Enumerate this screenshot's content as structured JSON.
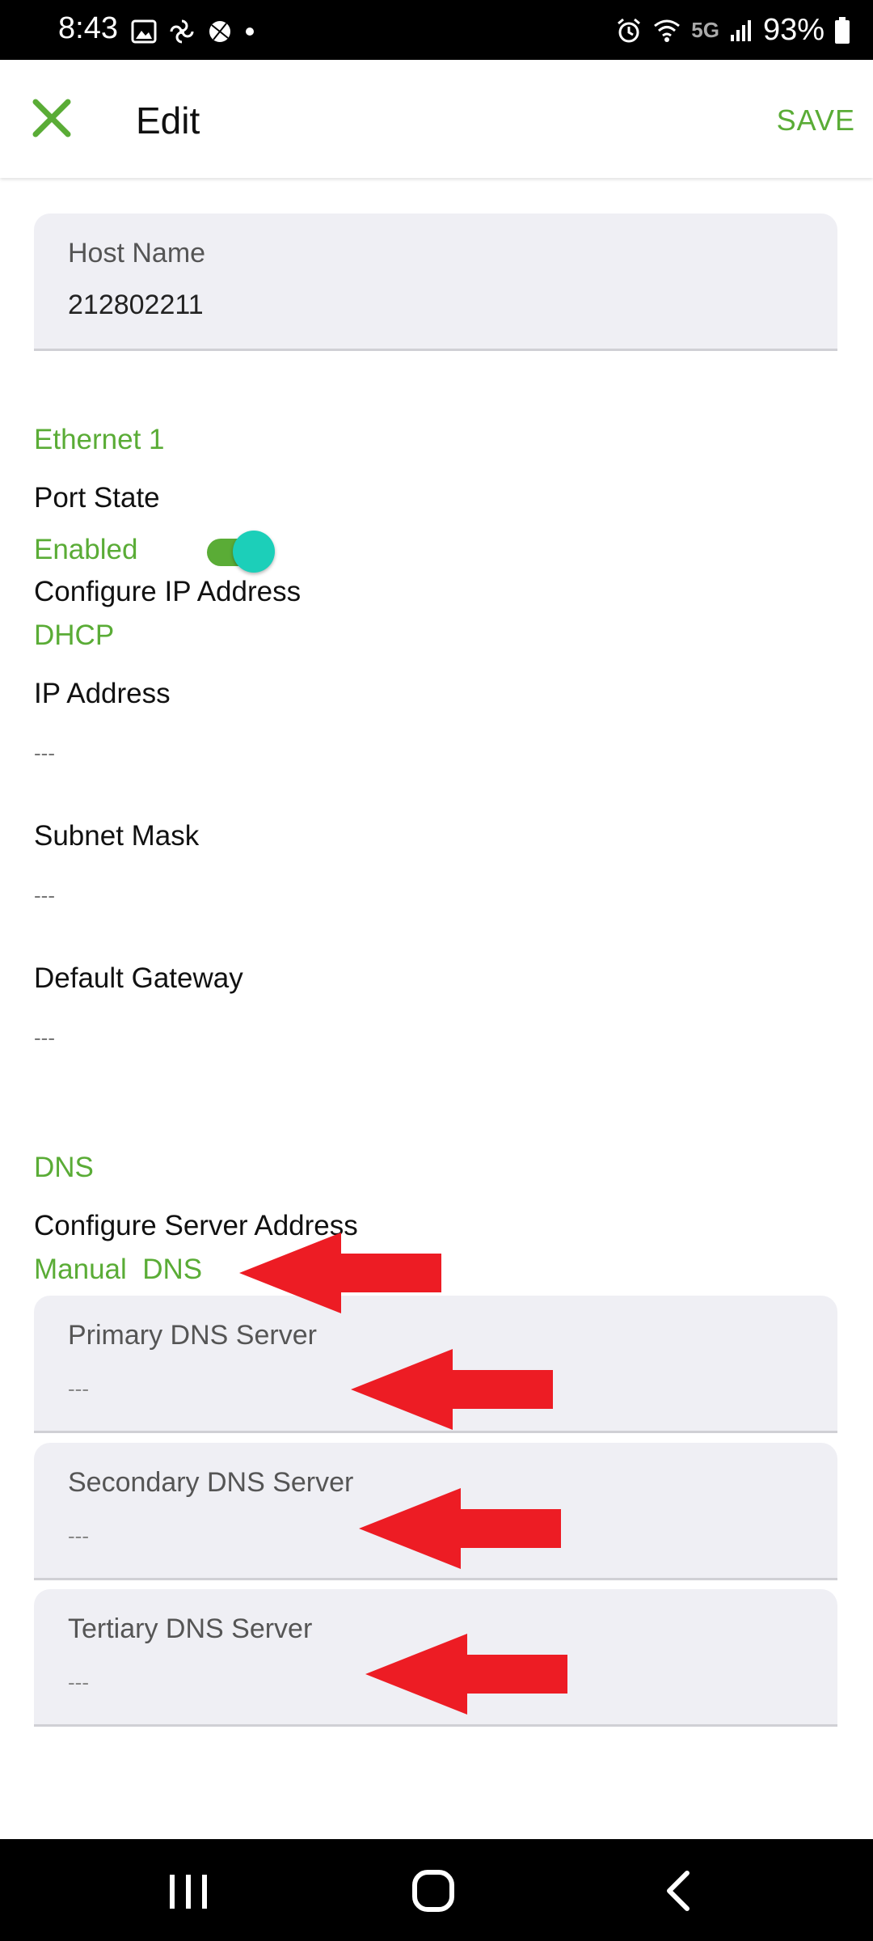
{
  "status_bar": {
    "time": "8:43",
    "network": "5G",
    "battery": "93%"
  },
  "app_bar": {
    "title": "Edit",
    "save_label": "SAVE",
    "close_icon": "close-x-icon"
  },
  "host": {
    "label": "Host Name",
    "value": "212802211"
  },
  "ethernet": {
    "section_title": "Ethernet 1",
    "port_state_label": "Port State",
    "port_state_value": "Enabled",
    "port_state_on": true,
    "configure_ip_label": "Configure IP Address",
    "configure_ip_value": "DHCP",
    "ip_label": "IP Address",
    "ip_value": "---",
    "subnet_label": "Subnet Mask",
    "subnet_value": "---",
    "gateway_label": "Default Gateway",
    "gateway_value": "---"
  },
  "dns": {
    "section_title": "DNS",
    "configure_label": "Configure Server Address",
    "configure_value": "Manual  DNS",
    "primary_label": "Primary DNS Server",
    "primary_value": "---",
    "secondary_label": "Secondary DNS Server",
    "secondary_value": "---",
    "tertiary_label": "Tertiary DNS Server",
    "tertiary_value": "---"
  },
  "colors": {
    "accent": "#5aac36",
    "toggle_knob": "#1ccfb9",
    "arrow": "#ed1c24"
  }
}
